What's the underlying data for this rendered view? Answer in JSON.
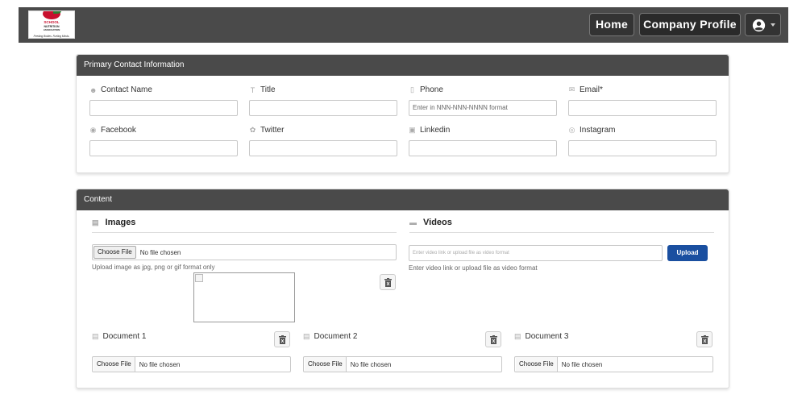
{
  "navbar": {
    "logo_text": {
      "school": "SCHOOL",
      "nutrition": "NUTRITION",
      "association": "ASSOCIATION",
      "tagline": "Feeding Bodies. Fueling Minds."
    },
    "home_label": "Home",
    "company_profile_label": "Company Profile"
  },
  "primary_contact": {
    "title": "Primary Contact Information",
    "fields": [
      {
        "label": "Contact Name",
        "icon": "user-icon",
        "value": "",
        "placeholder": ""
      },
      {
        "label": "Title",
        "icon": "title-icon",
        "value": "",
        "placeholder": ""
      },
      {
        "label": "Phone",
        "icon": "phone-icon",
        "value": "",
        "placeholder": "Enter in NNN-NNN-NNNN format"
      },
      {
        "label": "Email*",
        "icon": "email-icon",
        "value": "",
        "placeholder": ""
      },
      {
        "label": "Facebook",
        "icon": "facebook-icon",
        "value": "",
        "placeholder": ""
      },
      {
        "label": "Twitter",
        "icon": "twitter-icon",
        "value": "",
        "placeholder": ""
      },
      {
        "label": "Linkedin",
        "icon": "linkedin-icon",
        "value": "",
        "placeholder": ""
      },
      {
        "label": "Instagram",
        "icon": "instagram-icon",
        "value": "",
        "placeholder": ""
      }
    ]
  },
  "content": {
    "title": "Content",
    "images": {
      "title": "Images",
      "file_button": "Choose File",
      "file_status": "No file chosen",
      "hint": "Upload image as jpg, png or gif format only"
    },
    "videos": {
      "title": "Videos",
      "placeholder": "Enter video link or upload file as video format",
      "hint": "Enter video link or upload file as video format",
      "upload_label": "Upload"
    },
    "documents": [
      {
        "label": "Document 1",
        "file_button": "Choose File",
        "file_status": "No file chosen"
      },
      {
        "label": "Document 2",
        "file_button": "Choose File",
        "file_status": "No file chosen"
      },
      {
        "label": "Document 3",
        "file_button": "Choose File",
        "file_status": "No file chosen"
      }
    ]
  },
  "colors": {
    "header_bg": "#4a4a4a",
    "upload_button": "#1a4fa0"
  }
}
